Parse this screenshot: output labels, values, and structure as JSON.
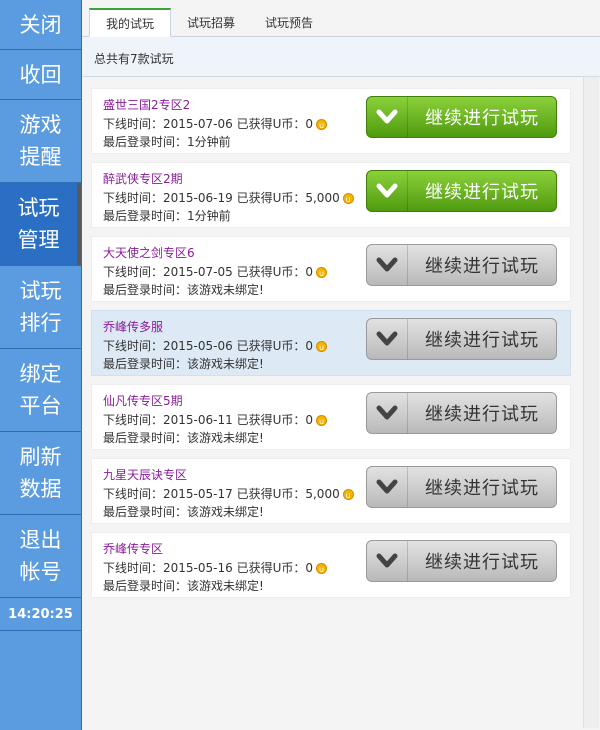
{
  "sidebar": {
    "items": [
      {
        "name": "sidebar-item-close",
        "lines": [
          "关闭"
        ]
      },
      {
        "name": "sidebar-item-collapse",
        "lines": [
          "收回"
        ]
      },
      {
        "name": "sidebar-item-game-reminder",
        "lines": [
          "游戏",
          "提醒"
        ]
      },
      {
        "name": "sidebar-item-trial-manage",
        "lines": [
          "试玩",
          "管理"
        ],
        "active": true
      },
      {
        "name": "sidebar-item-trial-rank",
        "lines": [
          "试玩",
          "排行"
        ]
      },
      {
        "name": "sidebar-item-bind-platform",
        "lines": [
          "绑定",
          "平台"
        ]
      },
      {
        "name": "sidebar-item-refresh",
        "lines": [
          "刷新",
          "数据"
        ]
      },
      {
        "name": "sidebar-item-logout",
        "lines": [
          "退出",
          "帐号"
        ]
      }
    ],
    "clock": "14:20:25"
  },
  "tabs": [
    "我的试玩",
    "试玩招募",
    "试玩预告"
  ],
  "summary": "总共有7款试玩",
  "list": [
    {
      "title": "盛世三国2专区2",
      "offline": "下线时间：2015-07-06",
      "earned": "已获得U币：0",
      "last_login": "最后登录时间：1分钟前",
      "button": "继续进行试玩",
      "style": "green"
    },
    {
      "title": "醉武侠专区2期",
      "offline": "下线时间：2015-06-19",
      "earned": "已获得U币：5,000",
      "last_login": "最后登录时间：1分钟前",
      "button": "继续进行试玩",
      "style": "green"
    },
    {
      "title": "大天使之剑专区6",
      "offline": "下线时间：2015-07-05",
      "earned": "已获得U币：0",
      "last_login": "最后登录时间：该游戏未绑定!",
      "button": "继续进行试玩",
      "style": "gray"
    },
    {
      "title": "乔峰传多服",
      "offline": "下线时间：2015-05-06",
      "earned": "已获得U币：0",
      "last_login": "最后登录时间：该游戏未绑定!",
      "button": "继续进行试玩",
      "style": "gray",
      "highlight": true
    },
    {
      "title": "仙凡传专区5期",
      "offline": "下线时间：2015-06-11",
      "earned": "已获得U币：0",
      "last_login": "最后登录时间：该游戏未绑定!",
      "button": "继续进行试玩",
      "style": "gray"
    },
    {
      "title": "九星天辰诀专区",
      "offline": "下线时间：2015-05-17",
      "earned": "已获得U币：5,000",
      "last_login": "最后登录时间：该游戏未绑定!",
      "button": "继续进行试玩",
      "style": "gray"
    },
    {
      "title": "乔峰传专区",
      "offline": "下线时间：2015-05-16",
      "earned": "已获得U币：0",
      "last_login": "最后登录时间：该游戏未绑定!",
      "button": "继续进行试玩",
      "style": "gray"
    }
  ],
  "icons": {
    "coin": "coin-icon",
    "chevron": "chevron-down-icon"
  },
  "colors": {
    "sidebar": "#5b9be0",
    "active": "#2a6fc4",
    "title": "#8a1c9a",
    "green_button": "#5aa514",
    "gray_button": "#cfcfcf"
  }
}
